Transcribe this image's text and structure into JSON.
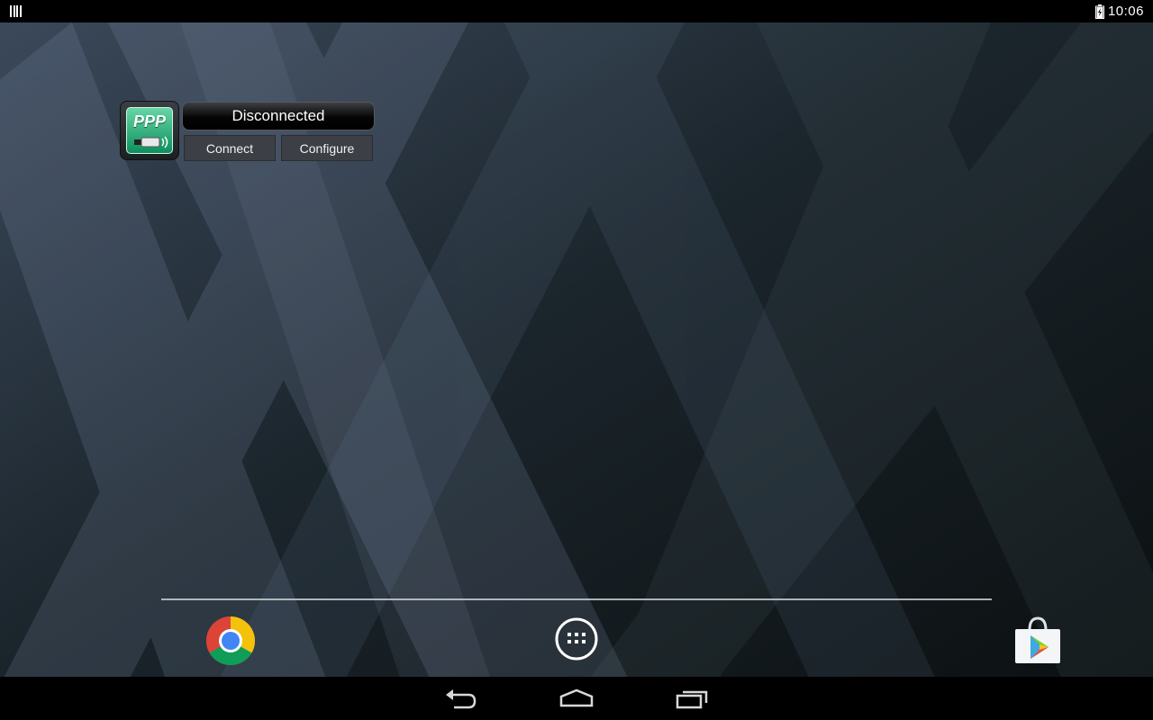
{
  "status_bar": {
    "time": "10:06",
    "left_icon": "barcode-icon",
    "battery_icon": "battery-charging-icon"
  },
  "widget": {
    "app_icon_text": "PPP",
    "status": "Disconnected",
    "connect_label": "Connect",
    "configure_label": "Configure"
  },
  "dock": {
    "items": [
      {
        "name": "chrome",
        "icon": "chrome-icon"
      },
      {
        "name": "all-apps",
        "icon": "app-grid-icon"
      },
      {
        "name": "play-store",
        "icon": "play-store-icon"
      }
    ]
  },
  "nav_bar": {
    "buttons": [
      "back",
      "home",
      "recents"
    ]
  },
  "colors": {
    "wallpaper_base": "#0d1114",
    "widget_button": "#3c4046",
    "ppp_green": "#1fb27a"
  }
}
